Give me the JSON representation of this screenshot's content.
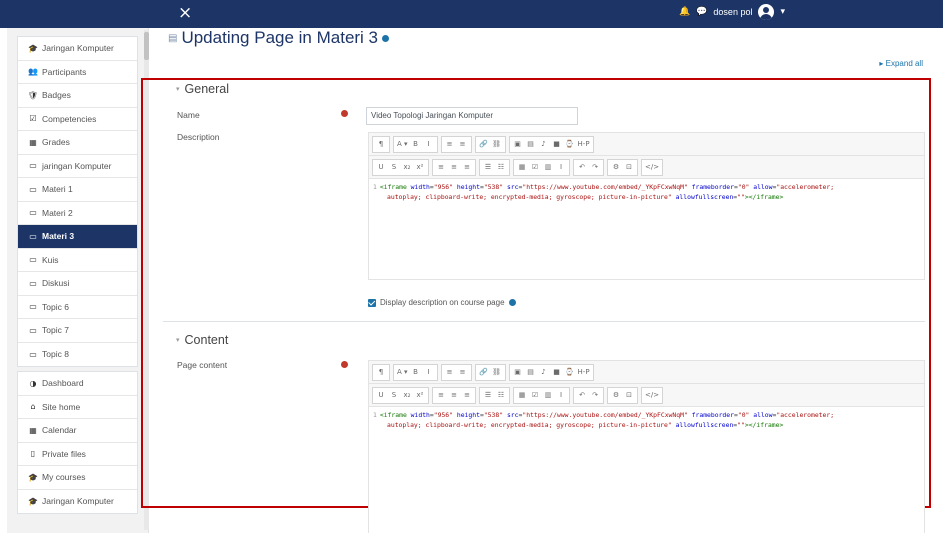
{
  "navbar": {
    "close_icon": "×",
    "bell_icon": "🔔",
    "chat_icon": "💬",
    "user_name": "dosen pol",
    "dropdown_icon": "▾"
  },
  "sidebar": {
    "course_group": [
      {
        "icon": "🎓",
        "label": "Jaringan Komputer",
        "active": false
      },
      {
        "icon": "👥",
        "label": "Participants",
        "active": false
      },
      {
        "icon": "🛡",
        "label": "Badges",
        "active": false
      },
      {
        "icon": "☑",
        "label": "Competencies",
        "active": false
      },
      {
        "icon": "▦",
        "label": "Grades",
        "active": false
      },
      {
        "icon": "▭",
        "label": "jaringan Komputer",
        "active": false
      },
      {
        "icon": "▭",
        "label": "Materi 1",
        "active": false
      },
      {
        "icon": "▭",
        "label": "Materi 2",
        "active": false
      },
      {
        "icon": "▭",
        "label": "Materi 3",
        "active": true
      },
      {
        "icon": "▭",
        "label": "Kuis",
        "active": false
      },
      {
        "icon": "▭",
        "label": "Diskusi",
        "active": false
      },
      {
        "icon": "▭",
        "label": "Topic 6",
        "active": false
      },
      {
        "icon": "▭",
        "label": "Topic 7",
        "active": false
      },
      {
        "icon": "▭",
        "label": "Topic 8",
        "active": false
      }
    ],
    "nav_group": [
      {
        "icon": "◑",
        "label": "Dashboard",
        "active": false
      },
      {
        "icon": "⌂",
        "label": "Site home",
        "active": false
      },
      {
        "icon": "▦",
        "label": "Calendar",
        "active": false
      },
      {
        "icon": "▯",
        "label": "Private files",
        "active": false
      },
      {
        "icon": "🎓",
        "label": "My courses",
        "active": false
      },
      {
        "icon": "🎓",
        "label": "Jaringan Komputer",
        "active": false
      }
    ]
  },
  "page": {
    "title": "Updating Page in Materi 3",
    "expand_all": "▸ Expand all"
  },
  "general": {
    "heading": "General",
    "name_label": "Name",
    "name_value": "Video Topologi Jaringan Komputer",
    "description_label": "Description",
    "display_desc_label": "Display description on course page"
  },
  "content": {
    "heading": "Content",
    "page_content_label": "Page content"
  },
  "editor": {
    "toolbar_row1": [
      [
        "¶"
      ],
      [
        "A ▾",
        "B",
        "I"
      ],
      [
        "≡",
        "≡"
      ],
      [
        "🔗",
        "⛓"
      ],
      [
        "▣",
        "▤",
        "♪",
        "■",
        "⌚",
        "H-P"
      ]
    ],
    "toolbar_row2": [
      [
        "U",
        "S",
        "x₂",
        "x²"
      ],
      [
        "≡",
        "≡",
        "≡"
      ],
      [
        "☰",
        "☷"
      ],
      [
        "▦",
        "☑",
        "▥",
        "I"
      ],
      [
        "↶",
        "↷"
      ],
      [
        "⚙",
        "⊡"
      ],
      [
        "</>"
      ]
    ],
    "code_line_no": "1",
    "code_tag_open": "<iframe",
    "code_a1": "width",
    "code_v1": "\"956\"",
    "code_a2": "height",
    "code_v2": "\"538\"",
    "code_a3": "src",
    "code_v3": "\"https://www.youtube.com/embed/_YKpFCxwNqM\"",
    "code_a4": "frameborder",
    "code_v4": "\"0\"",
    "code_a5": "allow",
    "code_v5a": "\"accelerometer;",
    "code_v5b": "autoplay; clipboard-write; encrypted-media; gyroscope; picture-in-picture\"",
    "code_a6": "allowfullscreen",
    "code_v6": "\"\"",
    "code_tag_close": "></iframe>"
  },
  "colors": {
    "navbar": "#1d3566",
    "accent": "#1d73a8",
    "highlight_border": "#c00000",
    "required": "#c0392b"
  }
}
